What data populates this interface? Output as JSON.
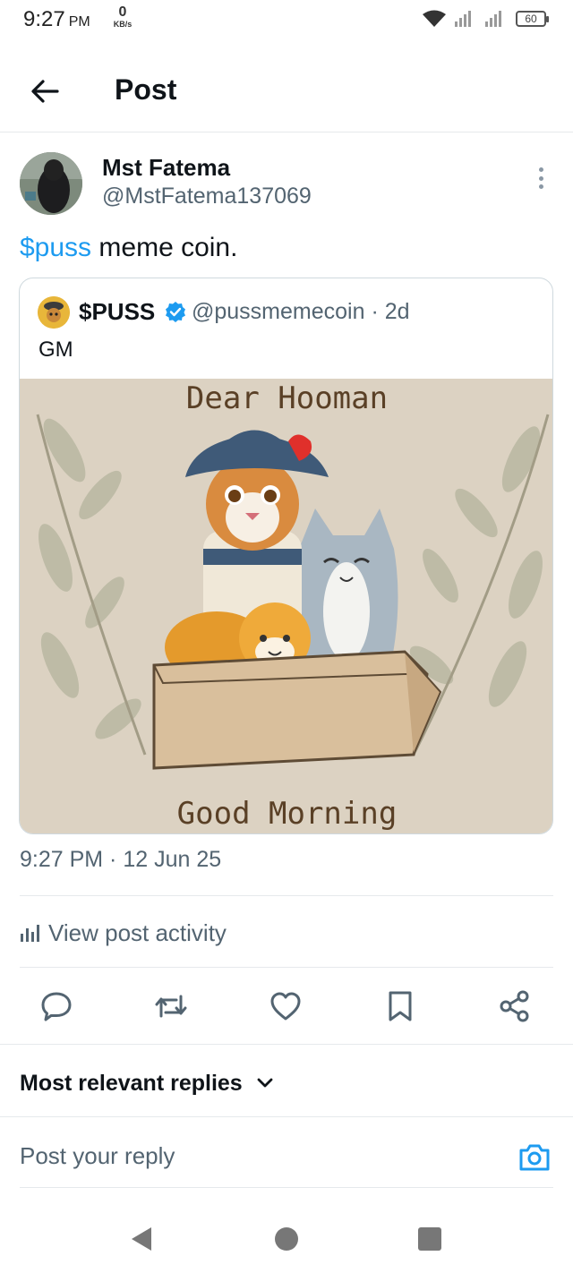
{
  "status_bar": {
    "time": "9:27",
    "ampm": "PM",
    "net_speed_value": "0",
    "net_speed_unit": "KB/s",
    "battery": "60"
  },
  "header": {
    "title": "Post"
  },
  "post": {
    "author_name": "Mst Fatema",
    "author_handle": "@MstFatema137069",
    "text_hashtag": "$puss",
    "text_rest": " meme coin.",
    "timestamp": "9:27 PM · 12 Jun 25"
  },
  "quoted_post": {
    "author_name": "$PUSS",
    "handle_and_age": "@pussmemecoin · 2d",
    "text": "GM",
    "image_top_text": "Dear Hooman",
    "image_bottom_text": "Good Morning"
  },
  "activity": {
    "label": "View post activity"
  },
  "actions": {
    "icons": [
      "reply-icon",
      "retweet-icon",
      "like-icon",
      "bookmark-icon",
      "share-icon"
    ]
  },
  "replies": {
    "sort_label": "Most relevant replies"
  },
  "reply_box": {
    "placeholder": "Post your reply"
  },
  "colors": {
    "accent": "#1d9bf0",
    "secondary_text": "#536471",
    "divider": "#e6e9ec"
  }
}
